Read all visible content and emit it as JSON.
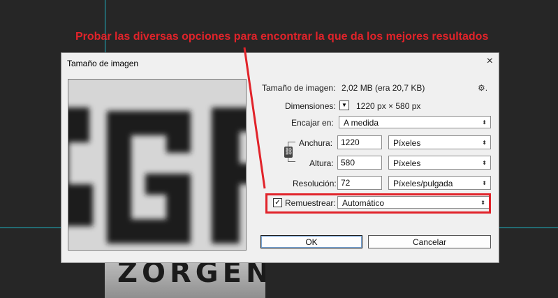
{
  "annotation": {
    "text": "Probar las diversas opciones para encontrar la que da los mejores resultados",
    "color": "#e1232a"
  },
  "background": {
    "canvas_text": "ZORGENA"
  },
  "dialog": {
    "title": "Tamaño de imagen",
    "close_icon": "×",
    "image_size_label": "Tamaño de imagen:",
    "image_size_value": "2,02 MB (era 20,7 KB)",
    "gear_icon": "⚙.",
    "dimensions_label": "Dimensiones:",
    "dimensions_value": "1220 px × 580 px",
    "fit_label": "Encajar en:",
    "fit_value": "A medida",
    "width_label": "Anchura:",
    "width_value": "1220",
    "width_unit": "Píxeles",
    "height_label": "Altura:",
    "height_value": "580",
    "height_unit": "Píxeles",
    "resolution_label": "Resolución:",
    "resolution_value": "72",
    "resolution_unit": "Píxeles/pulgada",
    "resample_label": "Remuestrear:",
    "resample_checked": true,
    "resample_value": "Automático",
    "ok_label": "OK",
    "cancel_label": "Cancelar",
    "preview_text": "GB"
  }
}
